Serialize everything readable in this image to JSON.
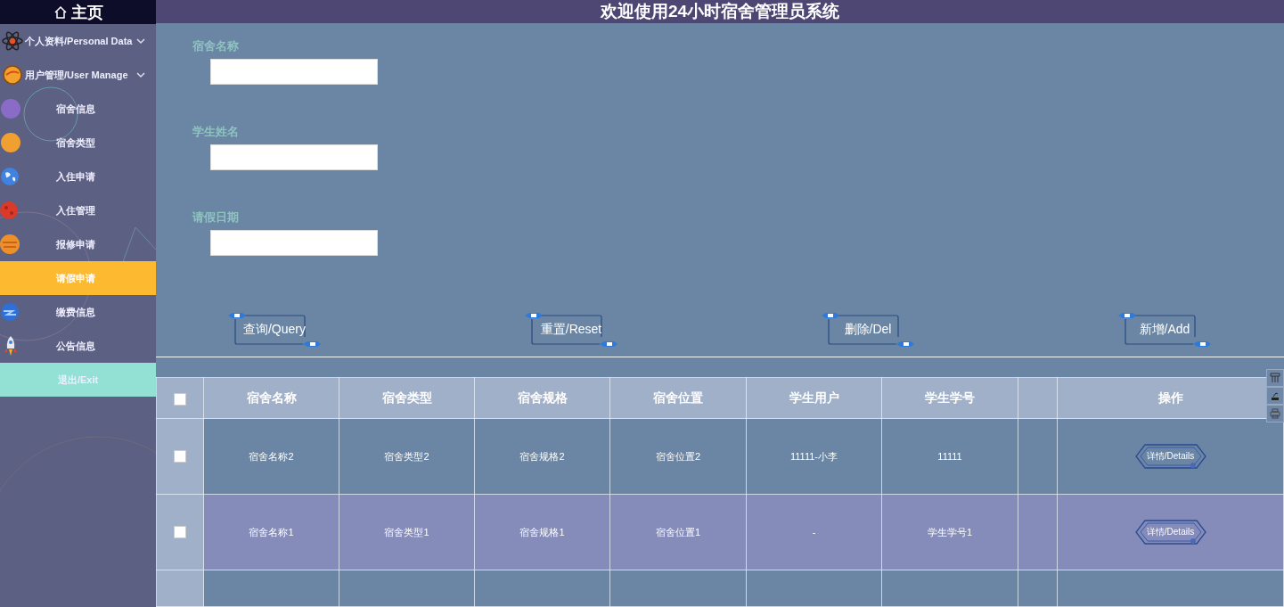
{
  "sidebar": {
    "home_label": "主页",
    "items": [
      {
        "label": "个人资料/Personal Data",
        "kind": "group",
        "selected": false
      },
      {
        "label": "用户管理/User Manage",
        "kind": "group",
        "selected": false
      },
      {
        "label": "宿舍信息",
        "kind": "link",
        "selected": false
      },
      {
        "label": "宿舍类型",
        "kind": "link",
        "selected": false
      },
      {
        "label": "入住申请",
        "kind": "link",
        "selected": false
      },
      {
        "label": "入住管理",
        "kind": "link",
        "selected": false
      },
      {
        "label": "报修申请",
        "kind": "link",
        "selected": false
      },
      {
        "label": "请假申请",
        "kind": "link",
        "selected": true
      },
      {
        "label": "缴费信息",
        "kind": "link",
        "selected": false
      },
      {
        "label": "公告信息",
        "kind": "link",
        "selected": false
      },
      {
        "label": "退出/Exit",
        "kind": "exit",
        "selected": false
      }
    ]
  },
  "header": {
    "title": "欢迎使用24小时宿舍管理员系统"
  },
  "search_form": {
    "fields": [
      {
        "label": "宿舍名称"
      },
      {
        "label": "学生姓名"
      },
      {
        "label": "请假日期"
      }
    ],
    "buttons": [
      "查询/Query",
      "重置/Reset",
      "删除/Del",
      "新增/Add"
    ]
  },
  "table": {
    "select_all_checked": false,
    "columns": [
      "宿舍名称",
      "宿舍类型",
      "宿舍规格",
      "宿舍位置",
      "学生用户",
      "学生学号",
      "操作"
    ],
    "rows": [
      {
        "checked": false,
        "highlighted": false,
        "cells": [
          "宿舍名称2",
          "宿舍类型2",
          "宿舍规格2",
          "宿舍位置2",
          "11111-小李",
          "11111"
        ],
        "action": "详情/Details"
      },
      {
        "checked": false,
        "highlighted": true,
        "cells": [
          "宿舍名称1",
          "宿舍类型1",
          "宿舍规格1",
          "宿舍位置1",
          "-",
          "学生学号1"
        ],
        "action": "详情/Details"
      }
    ]
  }
}
